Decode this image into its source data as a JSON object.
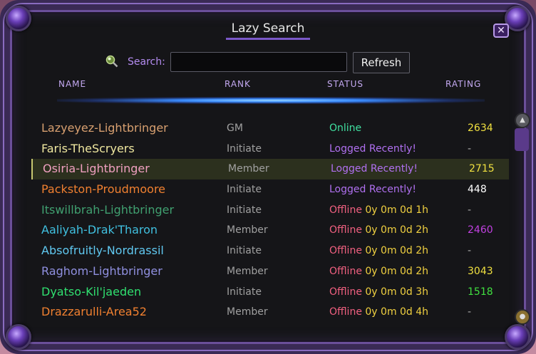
{
  "window": {
    "title": "Lazy Search",
    "close_label": "✕"
  },
  "search": {
    "label": "Search:",
    "value": "",
    "placeholder": "",
    "refresh_label": "Refresh"
  },
  "columns": {
    "name": "NAME",
    "rank": "RANK",
    "status": "STATUS",
    "rating": "RATING"
  },
  "rows": [
    {
      "name": "Lazyeyez-Lightbringer",
      "name_color": "#d8a070",
      "rank": "GM",
      "status": "Online",
      "status_color": "#40e0a0",
      "time": "",
      "rating": "2634",
      "rating_color": "#f0e040"
    },
    {
      "name": "Faris-TheScryers",
      "name_color": "#f0e8a0",
      "rank": "Initiate",
      "status": "Logged Recently!",
      "status_color": "#b070f0",
      "time": "",
      "rating": "-",
      "rating_color": "#aaaaaa"
    },
    {
      "name": "Osiria-Lightbringer",
      "name_color": "#f0a0c0",
      "rank": "Member",
      "status": "Logged Recently!",
      "status_color": "#b070f0",
      "time": "",
      "rating": "2715",
      "rating_color": "#f0e040"
    },
    {
      "name": "Packston-Proudmoore",
      "name_color": "#f08030",
      "rank": "Initiate",
      "status": "Logged Recently!",
      "status_color": "#b070f0",
      "time": "",
      "rating": "448",
      "rating_color": "#ffffff"
    },
    {
      "name": "Itswillbrah-Lightbringer",
      "name_color": "#40a070",
      "rank": "Initiate",
      "status": "Offline",
      "status_color": "#f06080",
      "time": "0y 0m 0d 1h",
      "rating": "-",
      "rating_color": "#aaaaaa"
    },
    {
      "name": "Aaliyah-Drak'Tharon",
      "name_color": "#40c0e0",
      "rank": "Member",
      "status": "Offline",
      "status_color": "#f06080",
      "time": "0y 0m 0d 2h",
      "rating": "2460",
      "rating_color": "#c040e0"
    },
    {
      "name": "Absofruitly-Nordrassil",
      "name_color": "#60c8f0",
      "rank": "Initiate",
      "status": "Offline",
      "status_color": "#f06080",
      "time": "0y 0m 0d 2h",
      "rating": "-",
      "rating_color": "#aaaaaa"
    },
    {
      "name": "Raghom-Lightbringer",
      "name_color": "#9090e0",
      "rank": "Member",
      "status": "Offline",
      "status_color": "#f06080",
      "time": "0y 0m 0d 2h",
      "rating": "3043",
      "rating_color": "#f0e040"
    },
    {
      "name": "Dyatso-Kil'jaeden",
      "name_color": "#30e070",
      "rank": "Initiate",
      "status": "Offline",
      "status_color": "#f06080",
      "time": "0y 0m 0d 3h",
      "rating": "1518",
      "rating_color": "#40e040"
    },
    {
      "name": "Drazzarulli-Area52",
      "name_color": "#f08030",
      "rank": "Member",
      "status": "Offline",
      "status_color": "#f06080",
      "time": "0y 0m 0d 4h",
      "rating": "-",
      "rating_color": "#aaaaaa"
    }
  ],
  "selected_row": 2,
  "icons": {
    "search": "magnifier-icon",
    "close": "close-icon"
  },
  "colors": {
    "accent": "#b48cf0",
    "frame": "#3a2a55"
  }
}
